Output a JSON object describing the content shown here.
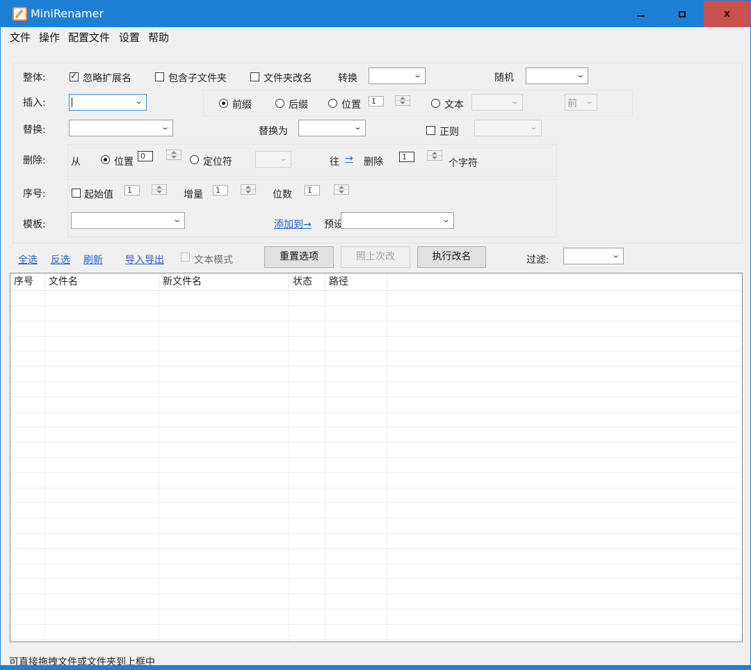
{
  "window": {
    "title": "MiniRenamer",
    "minimize_icon": "minimize-icon",
    "maximize_icon": "maximize-icon",
    "close_label": "x"
  },
  "menu": [
    "文件",
    "操作",
    "配置文件",
    "设置",
    "帮助"
  ],
  "overall": {
    "label": "整体:",
    "ignore_ext": "忽略扩展名",
    "ignore_ext_checked": true,
    "include_subfolders": "包含子文件夹",
    "rename_folders": "文件夹改名",
    "convert_label": "转换",
    "random_label": "随机"
  },
  "insert": {
    "label": "插入:",
    "prefix": "前缀",
    "suffix": "后缀",
    "position": "位置",
    "position_value": "1",
    "text": "文本",
    "front": "前",
    "selected": "前缀"
  },
  "replace": {
    "label": "替换:",
    "replace_with": "替换为",
    "regex": "正则"
  },
  "delete": {
    "label": "删除:",
    "from": "从",
    "position": "位置",
    "position_value": "0",
    "locator": "定位符",
    "direction": "往",
    "direction_arrow": "→",
    "delete": "删除",
    "count_value": "1",
    "chars": "个字符"
  },
  "sequence": {
    "label": "序号:",
    "start": "起始值",
    "start_value": "1",
    "step": "增量",
    "step_value": "1",
    "digits": "位数",
    "digits_value": "1"
  },
  "template": {
    "label": "模板:",
    "add_to": "添加到→",
    "preset": "预设"
  },
  "toolbar": {
    "select_all": "全选",
    "invert": "反选",
    "refresh": "刷新",
    "import_export": "导入导出",
    "text_mode": "文本模式",
    "reset": "重置选项",
    "last_change": "照上次改",
    "execute": "执行改名",
    "filter": "过滤:"
  },
  "table": {
    "columns": [
      "序号",
      "文件名",
      "新文件名",
      "状态",
      "路径"
    ]
  },
  "status_text": "可直接拖拽文件或文件夹到上框中"
}
